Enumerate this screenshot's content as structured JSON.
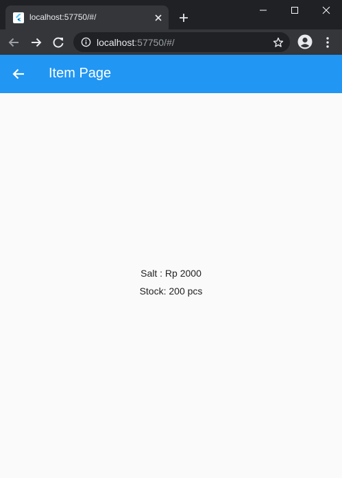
{
  "browser": {
    "tab": {
      "title": "localhost:57750/#/"
    },
    "omnibox": {
      "host": "localhost",
      "rest": ":57750/#/"
    }
  },
  "app_bar": {
    "title": "Item Page"
  },
  "item": {
    "price_line": "Salt : Rp 2000",
    "stock_line": "Stock:  200 pcs"
  },
  "colors": {
    "app_bar": "#2196f3",
    "browser_frame": "#202124",
    "browser_toolbar": "#35363a",
    "page_background": "#fafafa"
  },
  "icons": {
    "tab_favicon": "flutter-icon",
    "tab_close": "close-icon",
    "new_tab": "plus-icon",
    "back": "arrow-left-icon",
    "forward": "arrow-right-icon",
    "reload": "reload-icon",
    "site_info": "info-icon",
    "bookmark": "star-icon",
    "profile": "account-icon",
    "menu": "more-vert-icon",
    "app_back": "arrow-back-icon"
  }
}
